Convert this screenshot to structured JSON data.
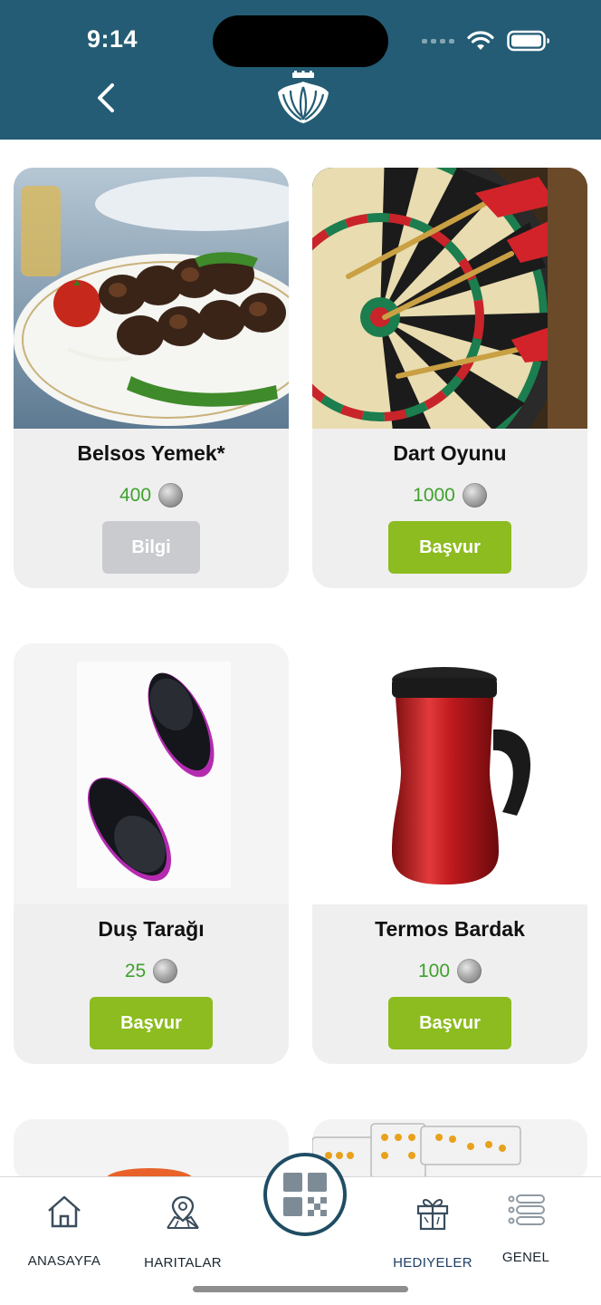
{
  "status_bar": {
    "time": "9:14"
  },
  "header": {
    "back_icon": "chevron-left-icon",
    "logo_icon": "city-emblem-icon",
    "background": "#235c74"
  },
  "products": [
    {
      "title": "Belsos Yemek*",
      "price": "400",
      "button_label": "Bilgi",
      "button_style": "disabled-grey",
      "image": "kebab-plate-photo"
    },
    {
      "title": "Dart Oyunu",
      "price": "1000",
      "button_label": "Başvur",
      "button_style": "primary-green",
      "image": "dartboard-photo"
    },
    {
      "title": "Duş Tarağı",
      "price": "25",
      "button_label": "Başvur",
      "button_style": "primary-green",
      "image": "hair-brush-photo"
    },
    {
      "title": "Termos Bardak",
      "price": "100",
      "button_label": "Başvur",
      "button_style": "primary-green",
      "image": "thermos-mug-photo"
    }
  ],
  "bottom_nav": {
    "items": [
      {
        "label": "ANASAYFA",
        "icon": "home-icon"
      },
      {
        "label": "HARITALAR",
        "icon": "map-icon"
      },
      {
        "label": "HEDIYELER",
        "icon": "gift-icon",
        "active": true
      },
      {
        "label": "GENEL",
        "icon": "list-icon"
      }
    ],
    "center_button_icon": "qr-code-icon"
  },
  "colors": {
    "accent_green": "#8cbc1f",
    "price_green": "#3fa12d",
    "header_teal": "#235c74",
    "disabled_grey": "#c9cbcf"
  }
}
